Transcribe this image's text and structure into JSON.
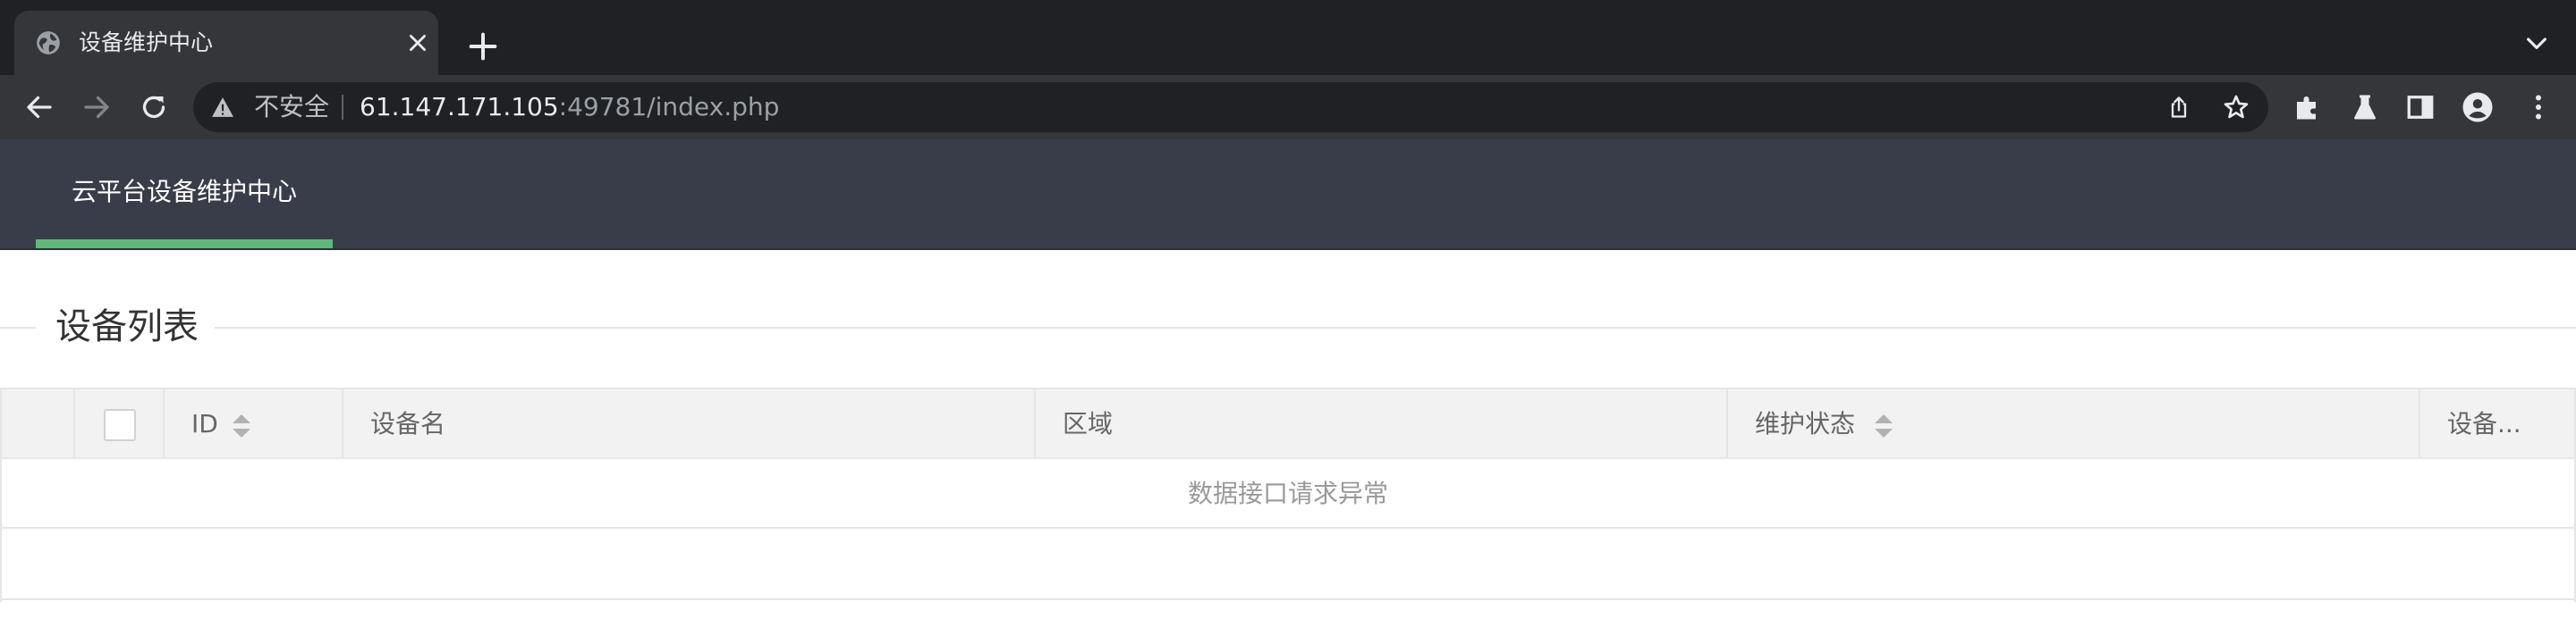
{
  "browser": {
    "tab_title": "设备维护中心",
    "security_label": "不安全",
    "url_host": "61.147.171.105",
    "url_rest": ":49781/index.php"
  },
  "header": {
    "brand": "云平台设备维护中心",
    "accent_color": "#5fb878",
    "background_color": "#393d49"
  },
  "section": {
    "title": "设备列表"
  },
  "table": {
    "columns": [
      {
        "label": "",
        "type": "checkbox"
      },
      {
        "label": "ID",
        "sortable": true
      },
      {
        "label": "设备名",
        "sortable": false
      },
      {
        "label": "区域",
        "sortable": false
      },
      {
        "label": "维护状态",
        "sortable": true
      },
      {
        "label": "设备...",
        "sortable": false
      }
    ],
    "empty_message": "数据接口请求异常"
  }
}
